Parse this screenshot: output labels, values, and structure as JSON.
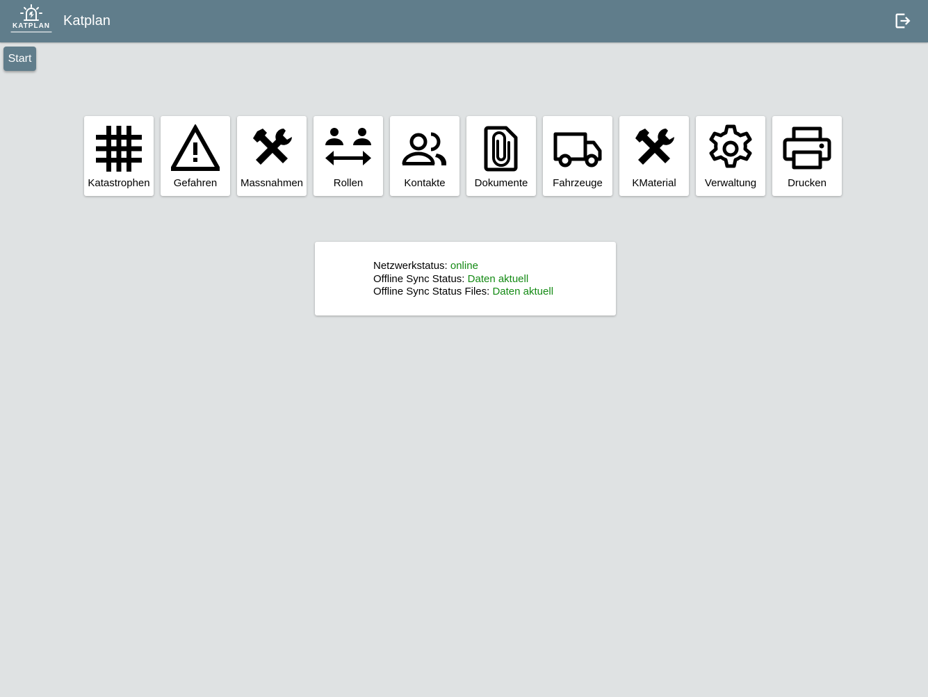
{
  "header": {
    "logo_text": "KATPLAN",
    "title": "Katplan",
    "logout_icon": "logout-icon"
  },
  "start_button": {
    "label": "Start"
  },
  "tiles": [
    {
      "label": "Katastrophen",
      "icon": "grid-icon"
    },
    {
      "label": "Gefahren",
      "icon": "warning-icon"
    },
    {
      "label": "Massnahmen",
      "icon": "tools-icon"
    },
    {
      "label": "Rollen",
      "icon": "swap-people-icon"
    },
    {
      "label": "Kontakte",
      "icon": "people-icon"
    },
    {
      "label": "Dokumente",
      "icon": "attachment-document-icon"
    },
    {
      "label": "Fahrzeuge",
      "icon": "truck-icon"
    },
    {
      "label": "KMaterial",
      "icon": "tools-icon"
    },
    {
      "label": "Verwaltung",
      "icon": "gear-icon"
    },
    {
      "label": "Drucken",
      "icon": "printer-icon"
    }
  ],
  "status": {
    "network_label": "Netzwerkstatus:",
    "network_value": "online",
    "sync_label": "Offline Sync Status:",
    "sync_value": "Daten aktuell",
    "files_label": "Offline Sync Status Files:",
    "files_value": "Daten aktuell",
    "ok_color": "#138a13"
  },
  "colors": {
    "header_bg": "#607d8b",
    "page_bg": "#dfe2e3"
  }
}
